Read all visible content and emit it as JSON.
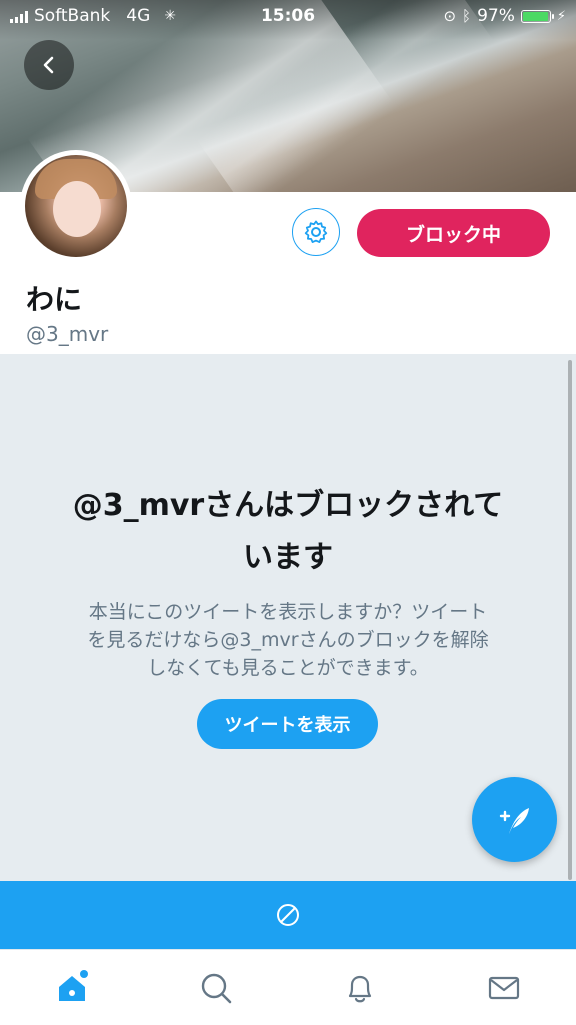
{
  "status_bar": {
    "carrier": "SoftBank",
    "network": "4G",
    "time": "15:06",
    "battery": "97%",
    "battery_level": 0.97
  },
  "profile": {
    "name": "わに",
    "handle": "@3_mvr",
    "block_button_label": "ブロック中"
  },
  "blocked_notice": {
    "title_line1": "@3_mvrさんはブロックされて",
    "title_line2": "います",
    "body_line1": "本当にこのツイートを表示しますか？ツイート",
    "body_line2": "を見るだけなら@3_mvrさんのブロックを解除",
    "body_line3": "しなくても見ることができます。",
    "show_button_label": "ツイートを表示"
  },
  "colors": {
    "accent": "#1da1f2",
    "block": "#e0245e",
    "panel_bg": "#e6ecf0",
    "muted_text": "#657786"
  },
  "icons": {
    "back": "chevron-left-icon",
    "settings": "gear-icon",
    "compose": "compose-tweet-icon",
    "blocked": "block-icon",
    "home": "home-icon",
    "search": "search-icon",
    "notifications": "bell-icon",
    "messages": "mail-icon"
  }
}
